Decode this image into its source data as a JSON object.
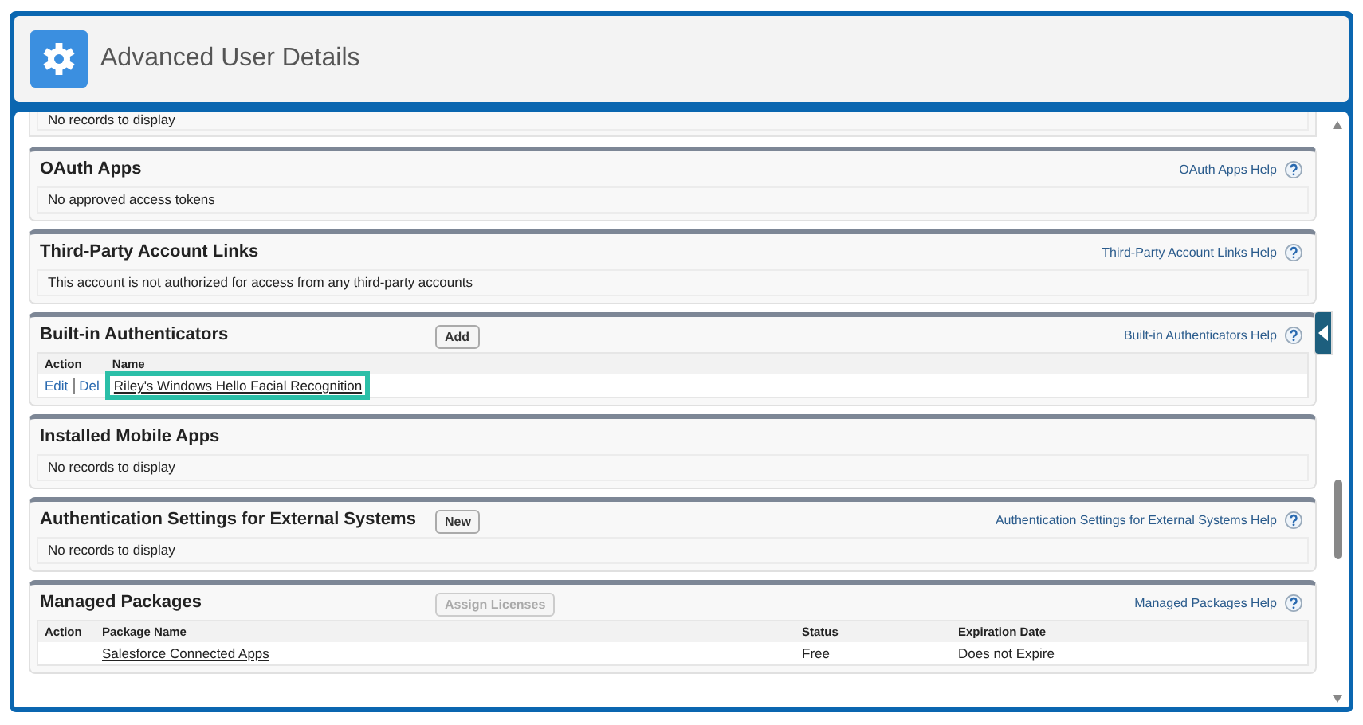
{
  "header": {
    "title": "Advanced User Details"
  },
  "top_remnant": {
    "message": "No records to display"
  },
  "sections": [
    {
      "kind": "message",
      "title": "OAuth Apps",
      "help": "OAuth Apps Help",
      "message": "No approved access tokens"
    },
    {
      "kind": "message",
      "title": "Third-Party Account Links",
      "help": "Third-Party Account Links Help",
      "message": "This account is not authorized for access from any third-party accounts"
    },
    {
      "kind": "table",
      "title": "Built-in Authenticators",
      "button": {
        "label": "Add",
        "disabled": false
      },
      "help": "Built-in Authenticators Help",
      "columns": [
        "Action",
        "Name"
      ],
      "rows": [
        {
          "cells": [
            {
              "kind": "actions",
              "actions": [
                "Edit",
                "Del"
              ]
            },
            {
              "kind": "link",
              "text": "Riley's Windows Hello Facial Recognition",
              "highlighted": true
            }
          ]
        }
      ]
    },
    {
      "kind": "message",
      "title": "Installed Mobile Apps",
      "message": "No records to display"
    },
    {
      "kind": "message",
      "title": "Authentication Settings for External Systems",
      "button": {
        "label": "New",
        "disabled": false
      },
      "help": "Authentication Settings for External Systems Help",
      "message": "No records to display"
    },
    {
      "kind": "table",
      "title": "Managed Packages",
      "button": {
        "label": "Assign Licenses",
        "disabled": true
      },
      "help": "Managed Packages Help",
      "columns": [
        "Action",
        "Package Name",
        "Status",
        "Expiration Date"
      ],
      "rows": [
        {
          "cells": [
            {
              "kind": "empty"
            },
            {
              "kind": "link",
              "text": "Salesforce Connected Apps",
              "highlighted": false
            },
            {
              "kind": "text",
              "text": "Free"
            },
            {
              "kind": "text",
              "text": "Does not Expire"
            }
          ]
        }
      ]
    }
  ]
}
